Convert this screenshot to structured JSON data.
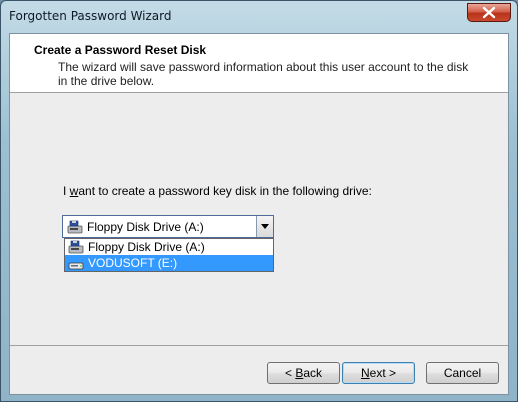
{
  "window": {
    "title": "Forgotten Password Wizard",
    "close_icon": "close-icon"
  },
  "header": {
    "title": "Create a Password Reset Disk",
    "description": "The wizard will save password information about this user account to the disk in the drive below."
  },
  "prompt": {
    "before": "I ",
    "accel": "w",
    "after": "ant to create a password key disk in the following drive:"
  },
  "drive_select": {
    "selected_value": "Floppy Disk Drive (A:)",
    "expanded": true,
    "options": [
      {
        "label": "Floppy Disk Drive (A:)",
        "icon": "floppy-drive-icon",
        "highlighted": false
      },
      {
        "label": "VODUSOFT (E:)",
        "icon": "removable-drive-icon",
        "highlighted": true
      }
    ]
  },
  "buttons": {
    "back": {
      "pre": "< ",
      "accel": "B",
      "post": "ack"
    },
    "next": {
      "pre": "",
      "accel": "N",
      "post": "ext >"
    },
    "cancel": "Cancel"
  },
  "colors": {
    "selection": "#3399ff",
    "close_button": "#c94a2f"
  }
}
